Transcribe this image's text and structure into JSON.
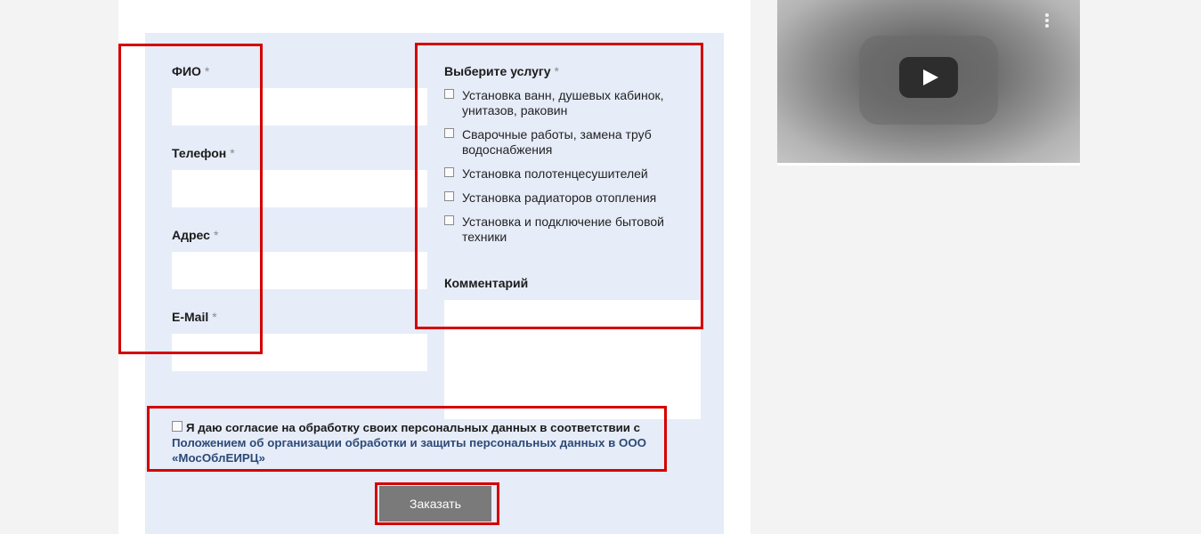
{
  "form": {
    "fields": [
      {
        "label": "ФИО",
        "required_mark": "*"
      },
      {
        "label": "Телефон",
        "required_mark": "*"
      },
      {
        "label": "Адрес",
        "required_mark": "*"
      },
      {
        "label": "E-Mail",
        "required_mark": "*"
      }
    ],
    "services": {
      "label": "Выберите услугу",
      "required_mark": "*",
      "options": [
        {
          "label": "Установка ванн, душевых кабинок, унитазов, раковин",
          "checked": false
        },
        {
          "label": "Сварочные работы, замена труб водоснабжения",
          "checked": false
        },
        {
          "label": "Установка полотенцесушителей",
          "checked": false
        },
        {
          "label": "Установка радиаторов отопления",
          "checked": false
        },
        {
          "label": "Установка и подключение бытовой техники",
          "checked": false
        }
      ]
    },
    "comment": {
      "label": "Комментарий",
      "value": ""
    },
    "consent": {
      "text": "Я даю согласие на обработку своих персональных данных в соответствии с",
      "link": "Положением об организации обработки и защиты персональных данных в ООО «МосОблЕИРЦ»",
      "checked": false
    },
    "submit_label": "Заказать"
  },
  "video": {
    "play_icon": "play-icon",
    "menu_icon": "more-vertical-icon"
  },
  "colors": {
    "panel": "#e6ecf8",
    "highlight": "#d40000",
    "button": "#7a7a7a",
    "link": "#2c4a78"
  }
}
